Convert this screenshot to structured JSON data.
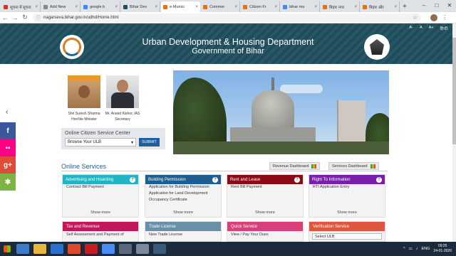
{
  "browser": {
    "tabs": [
      {
        "label": "सूचना में सूचना",
        "color": "#d93025",
        "active": false
      },
      {
        "label": "Add New",
        "color": "#888888",
        "active": false
      },
      {
        "label": "google b",
        "color": "#4285f4",
        "active": false
      },
      {
        "label": "Bihar Dev",
        "color": "#1f4f5f",
        "active": false
      },
      {
        "label": "e-Munici",
        "color": "#e8710a",
        "active": true
      },
      {
        "label": "Commer",
        "color": "#e8710a",
        "active": false
      },
      {
        "label": "Citizen Fr",
        "color": "#e8710a",
        "active": false
      },
      {
        "label": "bihar mu",
        "color": "#4285f4",
        "active": false
      },
      {
        "label": "बिहार नगर",
        "color": "#e8710a",
        "active": false
      },
      {
        "label": "बिहार और",
        "color": "#e8710a",
        "active": false
      }
    ],
    "url": "nagarseva.bihar.gov.in/udhd/Home.html",
    "new_tab": "+",
    "win_controls": [
      "–",
      "□",
      "✕"
    ]
  },
  "header": {
    "a11y": [
      "A-",
      "A",
      "A+",
      "हिन्दी"
    ],
    "title": "Urban Development & Housing Department",
    "subtitle": "Government of Bihar"
  },
  "officials": [
    {
      "name": "Shri Suresh Sharma",
      "role": "Hon'ble Minister"
    },
    {
      "name": "Mr. Anand Kishor, IAS",
      "role": "Secretary"
    }
  ],
  "service_center": {
    "title": "Online Citizen Service Center",
    "select_value": "Browse Your ULB",
    "submit": "SUBMIT"
  },
  "online_services": {
    "title": "Online Services",
    "revenue_dashboard": "Revenue Dashboard",
    "services_dashboard": "Services Dashboard",
    "cards": [
      {
        "title": "Advertising and Hoarding",
        "color": "#1fb5c4",
        "items": [
          "Contract Bill Payment"
        ],
        "more": "Show more"
      },
      {
        "title": "Building Permission",
        "color": "#1e5f8f",
        "items": [
          "Application for Building Permission",
          "Application for Land Development",
          "Occupancy Certificate"
        ],
        "more": "Show more"
      },
      {
        "title": "Rent and Lease",
        "color": "#8b0a14",
        "items": [
          "Rent Bill Payment"
        ],
        "more": "Show more"
      },
      {
        "title": "Right To Information",
        "color": "#7a1fa8",
        "items": [
          "RTI Application Entry"
        ],
        "more": "Show more"
      }
    ],
    "cards_row2": [
      {
        "title": "Tax and Revenue",
        "color": "#c2185b",
        "items": [
          "Self Assessment and Payment of"
        ]
      },
      {
        "title": "Trade License",
        "color": "#6a90a8",
        "items": [
          "New Trade License"
        ]
      },
      {
        "title": "Quick Service",
        "color": "#d9407a",
        "items": [
          "View / Pay Your Dues"
        ]
      },
      {
        "title": "Verification Service",
        "color": "#e0553f",
        "select": "Select ULB"
      }
    ]
  },
  "sharebar": [
    {
      "label": "f",
      "color": "#3b5998"
    },
    {
      "label": "▪▪",
      "color": "#ff0084"
    },
    {
      "label": "g+",
      "color": "#dd4b39"
    },
    {
      "label": "✱",
      "color": "#7cb342"
    }
  ],
  "taskbar": {
    "time": "09:25",
    "date": "24-01-2020",
    "tray": [
      "^",
      "▭",
      "♪",
      "ENG"
    ],
    "icons": [
      "#3d7cc9",
      "#e8b83a",
      "#2a6fd1",
      "#e04a2a",
      "#c41e1e",
      "#4c8bf5",
      "#5a6a7a",
      "#7a8a9a",
      "#3a5a7a"
    ]
  }
}
